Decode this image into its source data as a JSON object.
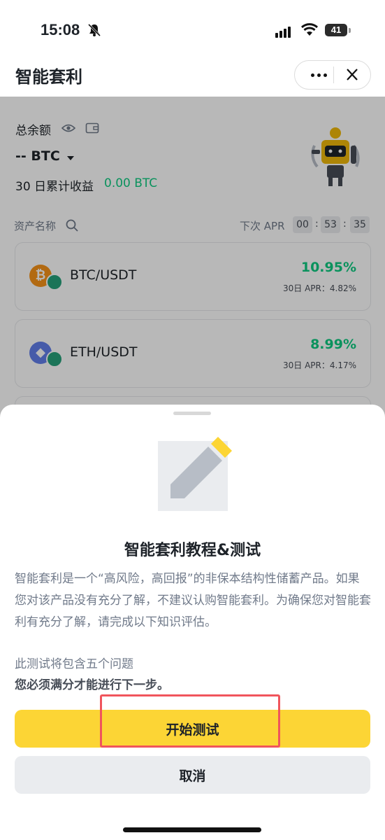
{
  "status_bar": {
    "time": "15:08",
    "battery": "41"
  },
  "header": {
    "title": "智能套利"
  },
  "summary": {
    "total_label": "总余额",
    "balance": "-- BTC",
    "earnings_label": "30 日累计收益",
    "earnings_value": "0.00 BTC"
  },
  "table": {
    "asset_col": "资产名称",
    "apr_col": "下次 APR",
    "timer": [
      "00",
      "53",
      "35"
    ]
  },
  "pairs": [
    {
      "name": "BTC/USDT",
      "apr": "10.95%",
      "apr30": "30日 APR：4.82%",
      "coin_color": "#f7931a",
      "coin_symbol": "₿"
    },
    {
      "name": "ETH/USDT",
      "apr": "8.99%",
      "apr30": "30日 APR：4.17%",
      "coin_color": "#627eea",
      "coin_symbol": "◆"
    }
  ],
  "sheet": {
    "title": "智能套利教程&测试",
    "description": "智能套利是一个“高风险，高回报”的非保本结构性储蓄产品。如果您对该产品没有充分了解，不建议认购智能套利。为确保您对智能套利有充分了解，请完成以下知识评估。",
    "note1": "此测试将包含五个问题",
    "note2": "您必须满分才能进行下一步。",
    "start_button": "开始测试",
    "cancel_button": "取消"
  },
  "colors": {
    "accent": "#fcd535",
    "positive": "#0ecb81",
    "highlight": "#f0555c"
  }
}
